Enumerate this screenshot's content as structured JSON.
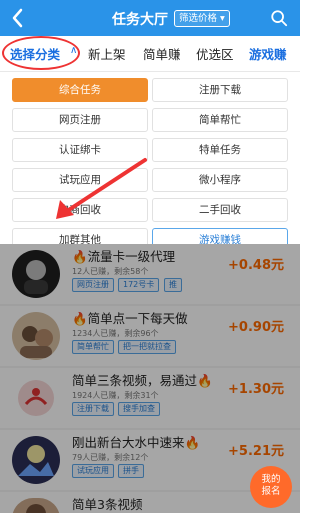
{
  "header": {
    "title": "任务大厅",
    "filter_label": "筛选价格 ▾"
  },
  "tabs": {
    "items": [
      "选择分类",
      "新上架",
      "简单赚",
      "优选区",
      "游戏赚"
    ],
    "active_index": 0
  },
  "categories": {
    "items": [
      "综合任务",
      "注册下载",
      "网页注册",
      "简单帮忙",
      "认证绑卡",
      "特单任务",
      "试玩应用",
      "微小程序",
      "电商回收",
      "二手回收",
      "加群其他",
      "游戏赚钱"
    ],
    "selected_index": 0
  },
  "tasks": [
    {
      "title": "🔥流量卡一级代理",
      "meta": "12人已赚，剩余58个",
      "tags": [
        "网页注册",
        "172号卡",
        "推"
      ],
      "price": "+0.48元"
    },
    {
      "title": "🔥简单点一下每天做",
      "meta": "1234人已赚，剩余96个",
      "tags": [
        "简单帮忙",
        "把一把就拉查"
      ],
      "price": "+0.90元"
    },
    {
      "title": "简单三条视频，易通过🔥",
      "meta": "1924人已赚，剩余31个",
      "tags": [
        "注册下载",
        "搜手加查"
      ],
      "price": "+1.30元"
    },
    {
      "title": "刚出新台大水中速来🔥",
      "meta": "79人已赚，剩余12个",
      "tags": [
        "试玩应用",
        "拼手"
      ],
      "price": "+5.21元"
    },
    {
      "title": "简单3条视频",
      "meta": "",
      "tags": [],
      "price": ""
    }
  ],
  "floating": {
    "line1": "我的",
    "line2": "报名"
  },
  "colors": {
    "header": "#2a93e8",
    "accent_orange": "#f08d2c",
    "price_orange": "#ff6a00",
    "annotation_red": "#e33"
  }
}
